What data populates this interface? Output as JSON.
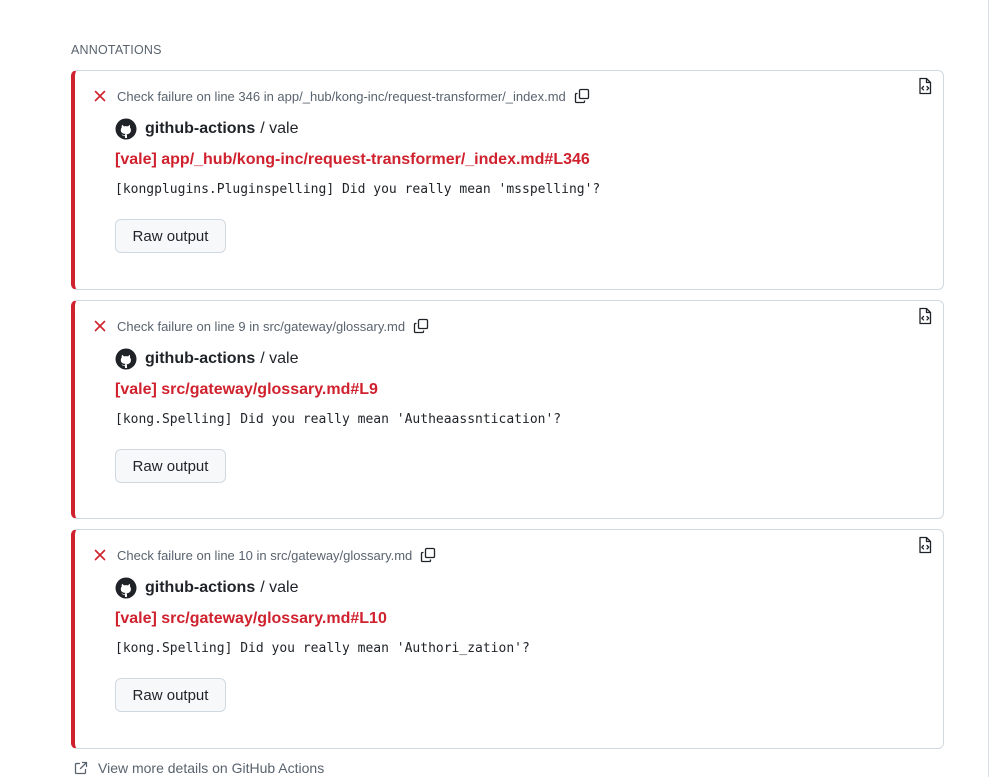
{
  "section": {
    "title": "ANNOTATIONS"
  },
  "annotations": [
    {
      "header": "Check failure on line 346 in app/_hub/kong-inc/request-transformer/_index.md",
      "author": "github-actions",
      "author_suffix": "/ vale",
      "title": "[vale] app/_hub/kong-inc/request-transformer/_index.md#L346",
      "message": "[kongplugins.Pluginspelling] Did you really mean 'msspelling'?",
      "button_label": "Raw output"
    },
    {
      "header": "Check failure on line 9 in src/gateway/glossary.md",
      "author": "github-actions",
      "author_suffix": "/ vale",
      "title": "[vale] src/gateway/glossary.md#L9",
      "message": "[kong.Spelling] Did you really mean 'Autheaassntication'?",
      "button_label": "Raw output"
    },
    {
      "header": "Check failure on line 10 in src/gateway/glossary.md",
      "author": "github-actions",
      "author_suffix": "/ vale",
      "title": "[vale] src/gateway/glossary.md#L10",
      "message": "[kong.Spelling] Did you really mean 'Authori_zation'?",
      "button_label": "Raw output"
    }
  ],
  "footer": {
    "link_label": "View more details on GitHub Actions"
  },
  "icons": {
    "failure": "x-icon",
    "copy": "copy-icon",
    "view_file": "file-code-icon",
    "author": "github-logo-icon",
    "external": "link-external-icon"
  },
  "colors": {
    "failure": "#cf222e",
    "muted": "#59636e",
    "border": "#d1d9e0",
    "button_bg": "#f6f8fa"
  }
}
